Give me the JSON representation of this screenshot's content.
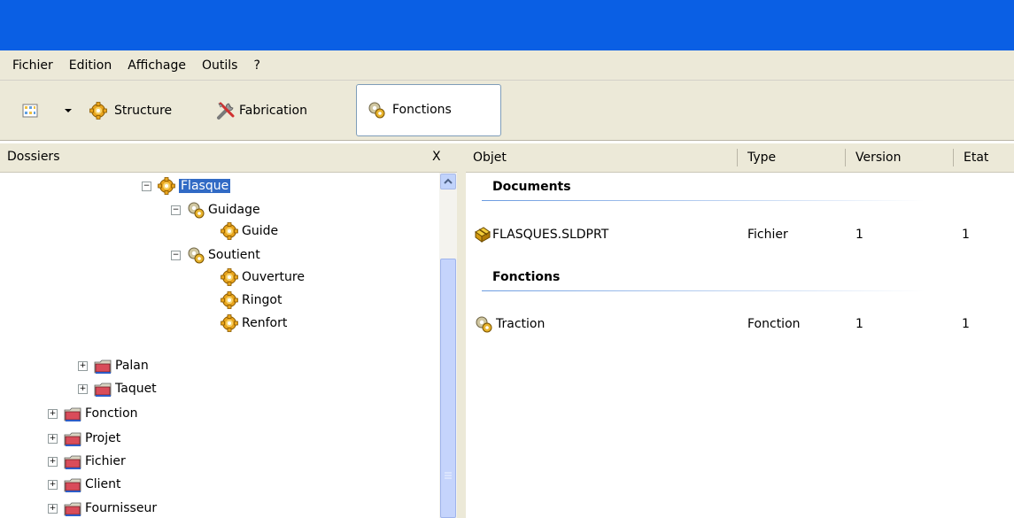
{
  "menu": [
    "Fichier",
    "Edition",
    "Affichage",
    "Outils",
    "?"
  ],
  "toolbar": {
    "structure": "Structure",
    "fabrication": "Fabrication",
    "fonctions": "Fonctions"
  },
  "left_panel": {
    "title": "Dossiers",
    "close": "X"
  },
  "tree": {
    "flasque": "Flasque",
    "guidage": "Guidage",
    "guide": "Guide",
    "soutient": "Soutient",
    "ouverture": "Ouverture",
    "ringot": "Ringot",
    "renfort": "Renfort",
    "palan": "Palan",
    "taquet": "Taquet",
    "fonction": "Fonction",
    "projet": "Projet",
    "fichier": "Fichier",
    "client": "Client",
    "fournisseur": "Fournisseur"
  },
  "columns": {
    "objet": "Objet",
    "type": "Type",
    "version": "Version",
    "etat": "Etat"
  },
  "sections": {
    "documents": {
      "title": "Documents",
      "row": {
        "objet": "FLASQUES.SLDPRT",
        "type": "Fichier",
        "version": "1",
        "etat": "1"
      }
    },
    "fonctions": {
      "title": "Fonctions",
      "row": {
        "objet": "Traction",
        "type": "Fonction",
        "version": "1",
        "etat": "1"
      }
    }
  },
  "colors": {
    "titlebar": "#0a5fe4",
    "chrome": "#ece9d8",
    "selection": "#316ac5"
  }
}
